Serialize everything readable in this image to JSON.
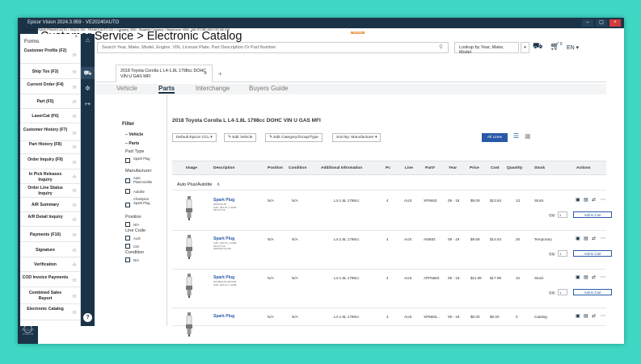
{
  "window": {
    "title": "Epicor Vision 2024.3.959 - VE20240AUTO",
    "min_label": "–",
    "max_label": "▢",
    "close_label": "×"
  },
  "page": {
    "title": "Customer Service > Electronic Catalog",
    "infobar": "Customer: PRANK PRANKS AUTO > ShipTo: 002 - PRANKS AUTO 002 > Company: 0051 - Required Company > Warehouse: 0060 - 660 STORE #56 FOR WD 630"
  },
  "rail": {
    "icons": [
      "home-icon",
      "menu-icon",
      "favorites-icon",
      "add-icon",
      "collapse-icon",
      "help-circle-icon"
    ],
    "logo": "EPICOR VISION"
  },
  "forms": {
    "title": "Forms",
    "close": "×",
    "items": [
      {
        "label": "Customer Profile (F2)"
      },
      {
        "label": "Ship Tos (F3)"
      },
      {
        "label": "Current Order (F4)"
      },
      {
        "label": "Part (F5)"
      },
      {
        "label": "LaserCat (F6)"
      },
      {
        "label": "Customer History (F7)"
      },
      {
        "label": "Part History (F8)"
      },
      {
        "label": "Order Inquiry (F9)"
      },
      {
        "label": "In Pick Releases Inquiry"
      },
      {
        "label": "Order Line Status Inquiry"
      },
      {
        "label": "A/R Summary"
      },
      {
        "label": "A/R Detail Inquiry"
      },
      {
        "label": "Payments (F10)"
      },
      {
        "label": "Signature"
      },
      {
        "label": "Verification"
      },
      {
        "label": "COD Invoice Payments"
      },
      {
        "label": "Combined Sales Report"
      },
      {
        "label": "Electronic Catalog"
      }
    ]
  },
  "toolrail": {
    "icons": [
      "home-icon",
      "vehicle-icon",
      "settings-icon",
      "logout-icon",
      "help-icon"
    ]
  },
  "tag": "Test Mode",
  "search": {
    "placeholder": "Search Year, Make, Model, Engine, VIN, License Plate, Part Description Or Part Number",
    "lookup": "Lookup by Year, Make, Model",
    "cart_count": "0",
    "lang": "EN"
  },
  "doc_tab": {
    "label": "2018 Toyota Corolla L L4-1.8L 1798cc DOHC VIN U GAS MFI",
    "close": "×",
    "add": "+"
  },
  "subtabs": [
    "Vehicle",
    "Parts",
    "Interchange",
    "Buyers Guide"
  ],
  "filter": {
    "title": "Filter",
    "vehicle": "Vehicle",
    "parts": "Parts",
    "part_type": "Part Type",
    "part_type_opts": [
      "Spark Plug"
    ],
    "manufacturer": "Manufacturer",
    "manufacturer_opts": [
      "Auto Plus/Autolite",
      "Autolite",
      "Champion Spark Plug"
    ],
    "position": "Position",
    "position_opts": [
      "N/A"
    ],
    "line_code": "Line Code",
    "line_code_opts": [
      "AUS",
      "CIS"
    ],
    "condition": "Condition",
    "condition_opts": [
      "N/A"
    ]
  },
  "main": {
    "vehicle_title": "2018 Toyota Corolla L L4-1.8L 1798cc DOHC VIN U GAS MFI",
    "toolbar": {
      "catalog": "Default Epicor CCL",
      "edit_vehicle": "Edit Vehicle",
      "edit_category": "Edit Category/Group/Type",
      "sort": "Sort By: Manufacturer",
      "all_lines": "All Lines"
    },
    "columns": [
      "Image",
      "Description",
      "Position",
      "Condition",
      "Additional Information",
      "Pc",
      "Line",
      "Part#",
      "Year",
      "Price",
      "Cost",
      "Quantity",
      "Stock",
      "Actions"
    ],
    "group": "Auto Plus/Autolite",
    "qty_label": "Qty:",
    "qty_value": "1",
    "add_cart": "Add to Cart",
    "rows": [
      {
        "desc": "Spark Plug",
        "sub1": "IRIDIUM XP",
        "sub2": "GAP .044 IN | 1.1MM",
        "sub3": "OE STYLE",
        "position": "N/A",
        "condition": "N/A",
        "info": "L4-1.8L 1798cc",
        "pc": "4",
        "line": "AUS",
        "part": "XP5683",
        "year": "09 - 19",
        "price": "$9.09",
        "cost": "$13.84",
        "qty": "13",
        "stock": "Stock"
      },
      {
        "desc": "Spark Plug",
        "sub1": "GAP .044 IN | 1.1MM",
        "sub2": "OE STYLE",
        "sub3": "IRIDIUM ULTRA",
        "position": "N/A",
        "condition": "N/A",
        "info": "L4-1.8L 1798cc",
        "pc": "4",
        "line": "AUS",
        "part": "AI5683",
        "year": "09 - 19",
        "price": "$9.69",
        "cost": "$14.54",
        "qty": "26",
        "stock": "Temporary"
      },
      {
        "desc": "Spark Plug",
        "sub1": "DOUBLE PLATINUM",
        "sub2": "GAP .044 IN | 1.1MM",
        "sub3": "",
        "position": "N/A",
        "condition": "N/A",
        "info": "L4-1.8L 1798cc",
        "pc": "4",
        "line": "AUS",
        "part": "APP5683",
        "year": "09 - 19",
        "price": "$11.99",
        "cost": "$17.99",
        "qty": "10",
        "stock": "Stock"
      },
      {
        "desc": "Spark Plug",
        "sub1": "",
        "sub2": "",
        "sub3": "",
        "position": "N/A",
        "condition": "N/A",
        "info": "L4-1.8L 1798cc",
        "pc": "4",
        "line": "AUS",
        "part": "XP5683...",
        "year": "09 - 19",
        "price": "$0.00",
        "cost": "$0.00",
        "qty": "0",
        "stock": "Catalog"
      }
    ]
  },
  "colors": {
    "background": "#3fd7c4",
    "nav": "#1b3347",
    "accent": "#2a58a8"
  }
}
